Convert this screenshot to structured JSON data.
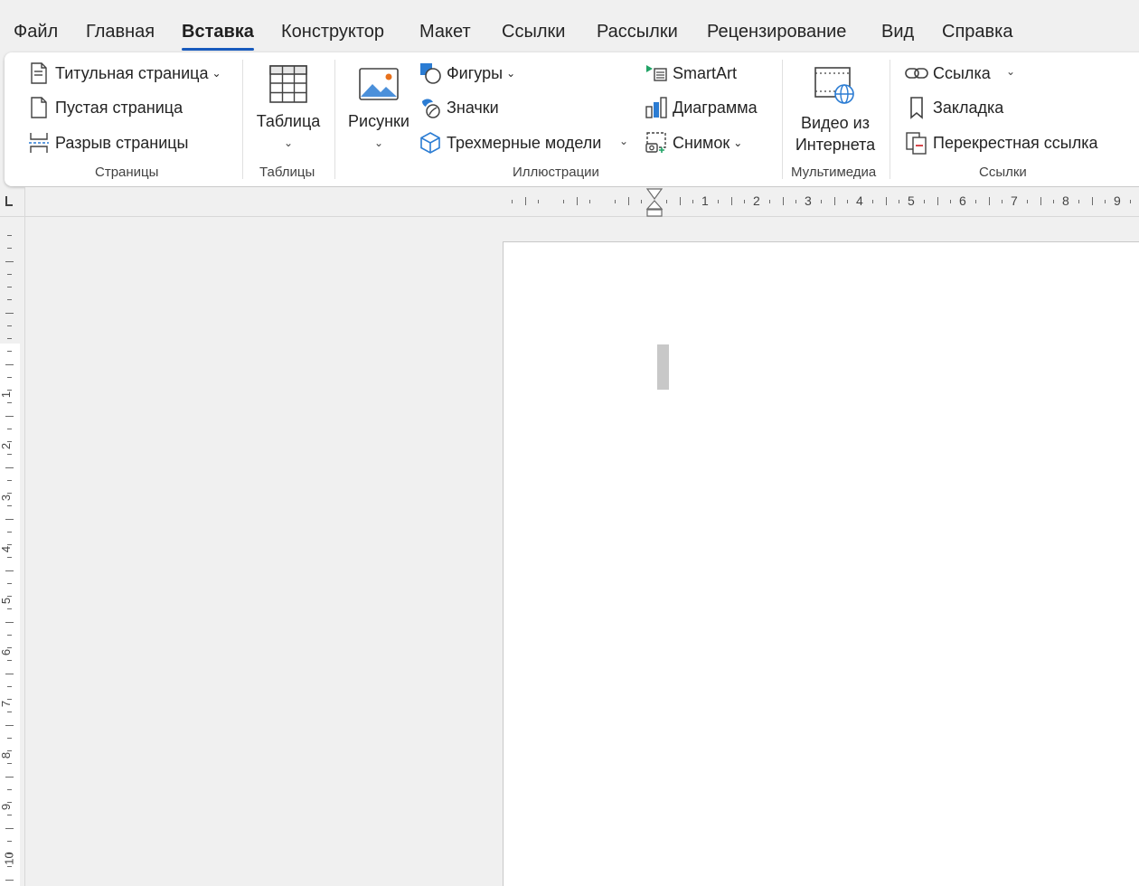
{
  "menu": {
    "tabs": [
      "Файл",
      "Главная",
      "Вставка",
      "Конструктор",
      "Макет",
      "Ссылки",
      "Рассылки",
      "Рецензирование",
      "Вид",
      "Справка"
    ],
    "active": "Вставка"
  },
  "ribbon": {
    "pages": {
      "title_page": "Титульная страница",
      "blank_page": "Пустая страница",
      "page_break": "Разрыв страницы",
      "label": "Страницы"
    },
    "tables": {
      "table": "Таблица",
      "label": "Таблицы"
    },
    "illustrations": {
      "pictures": "Рисунки",
      "shapes": "Фигуры",
      "icons": "Значки",
      "models_3d": "Трехмерные модели",
      "smartart": "SmartArt",
      "chart": "Диаграмма",
      "screenshot": "Снимок",
      "label": "Иллюстрации"
    },
    "media": {
      "online_video_line1": "Видео из",
      "online_video_line2": "Интернета",
      "label": "Мультимедиа"
    },
    "links": {
      "link": "Ссылка",
      "bookmark": "Закладка",
      "cross_reference": "Перекрестная ссылка",
      "label": "Ссылки"
    }
  },
  "ruler": {
    "horizontal": [
      "1",
      "2",
      "3",
      "4",
      "5",
      "6",
      "7",
      "8",
      "9"
    ],
    "vertical": [
      "1",
      "2",
      "3",
      "4",
      "5",
      "6",
      "7",
      "8",
      "9",
      "10"
    ]
  },
  "colors": {
    "accent": "#185abd",
    "icon_blue": "#2b7cd3",
    "icon_green": "#21a366",
    "ribbon_bg": "#ffffff",
    "window_bg": "#f0f0f0"
  }
}
